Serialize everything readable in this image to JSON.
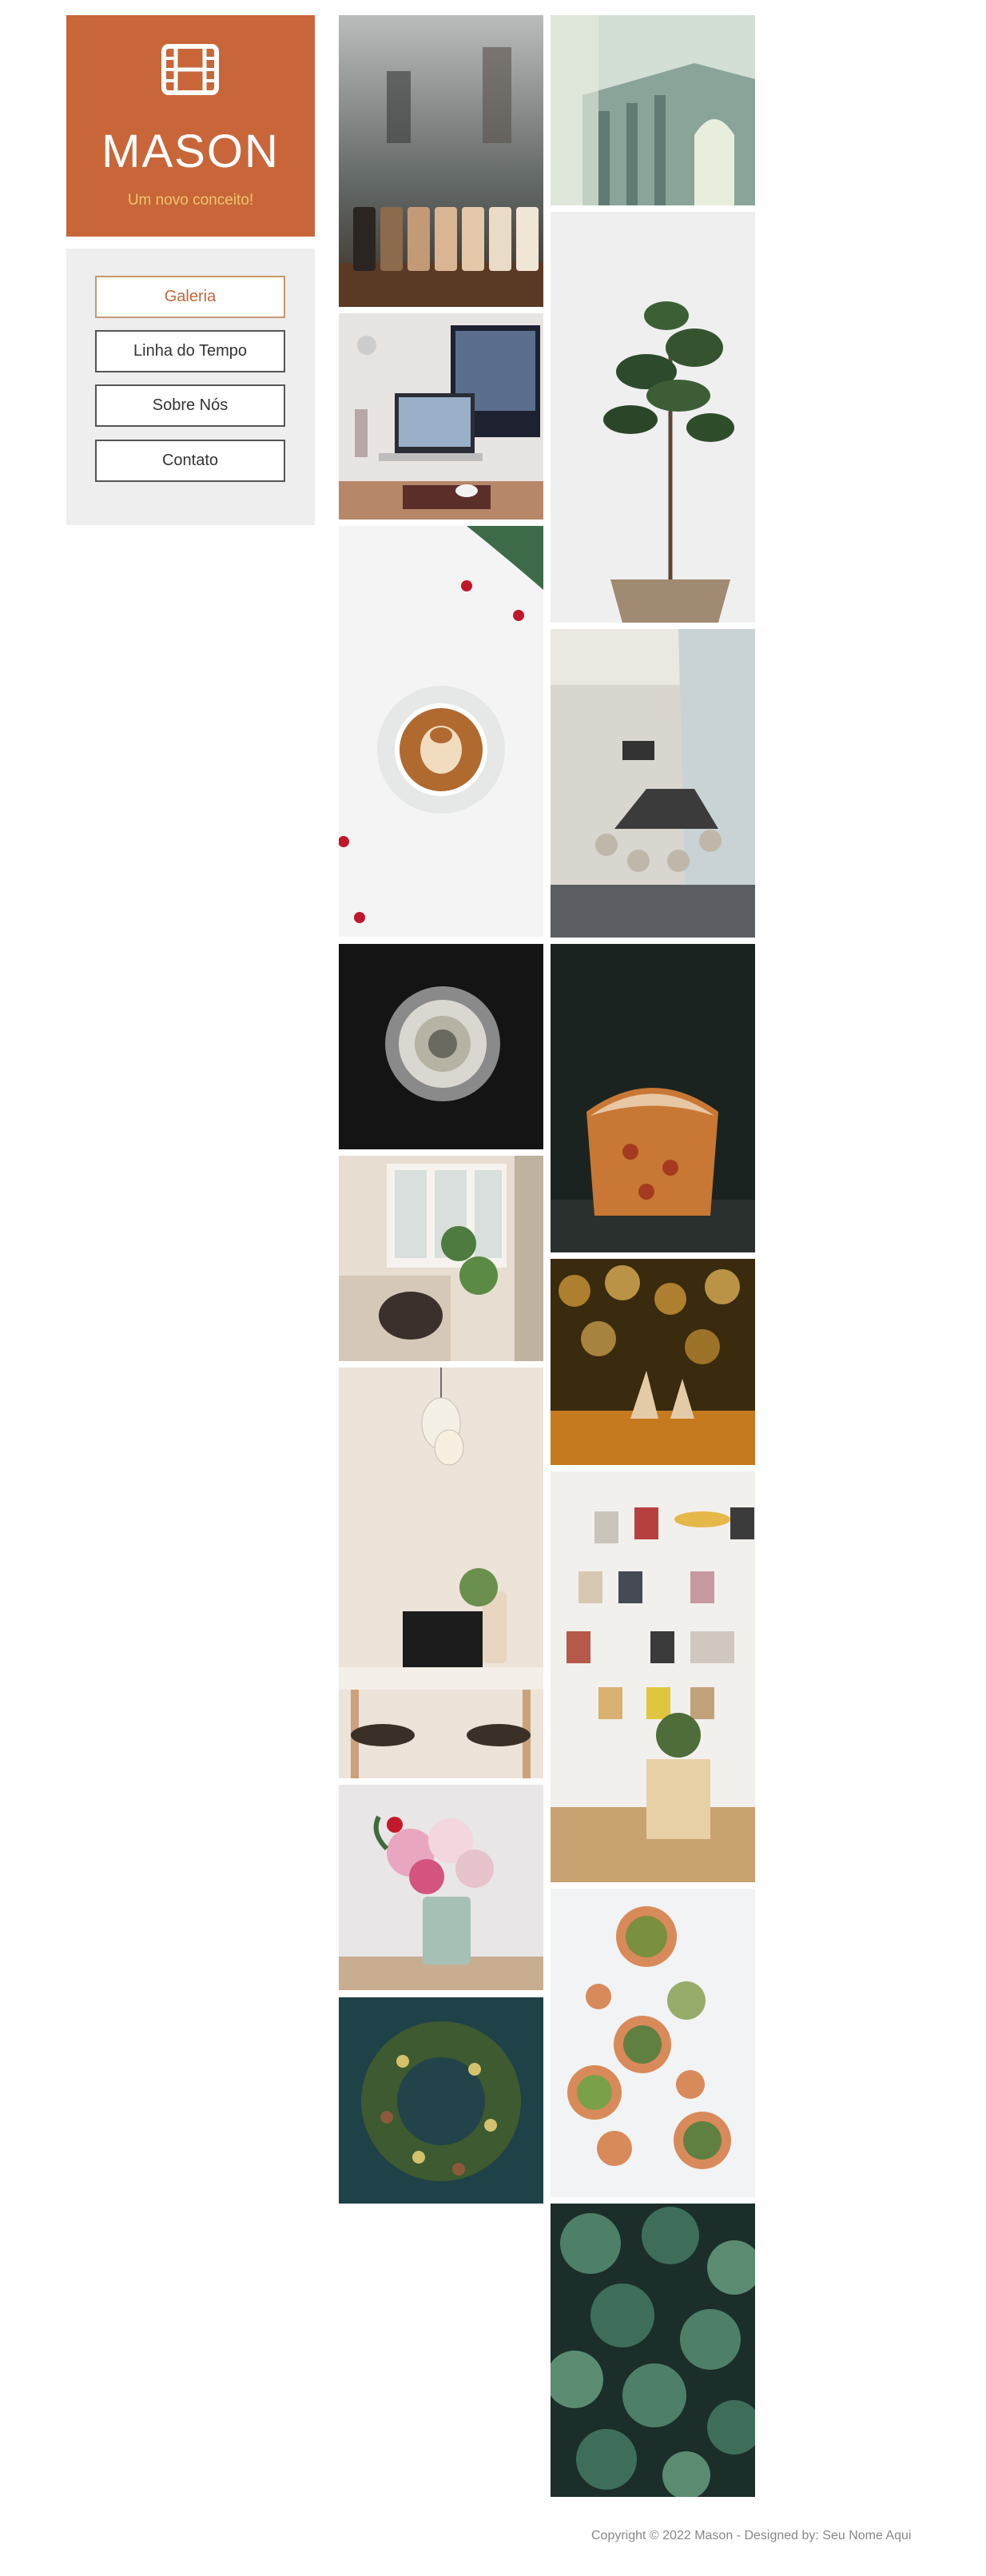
{
  "brand": {
    "icon": "film-icon",
    "title": "MASON",
    "tagline": "Um novo conceito!",
    "bg_color": "#c8663a",
    "tagline_color": "#f2c46b"
  },
  "nav": {
    "items": [
      {
        "label": "Galeria",
        "active": true
      },
      {
        "label": "Linha do Tempo",
        "active": false
      },
      {
        "label": "Sobre Nós",
        "active": false
      },
      {
        "label": "Contato",
        "active": false
      }
    ]
  },
  "gallery": {
    "images": [
      "coffee-jars-photo",
      "classical-building-photo",
      "plant-in-basket-photo",
      "desk-computers-photo",
      "latte-art-photo",
      "conference-room-photo",
      "white-rose-photo",
      "panettone-photo",
      "bedroom-window-photo",
      "bokeh-figurines-photo",
      "lamp-laptop-desk-photo",
      "pinned-cards-kitchen-photo",
      "flower-vase-photo",
      "succulent-pots-photo",
      "green-wreath-photo",
      "succulent-pattern-photo"
    ]
  },
  "footer": {
    "text": "Copyright © 2022 Mason - Designed by: Seu Nome Aqui"
  }
}
